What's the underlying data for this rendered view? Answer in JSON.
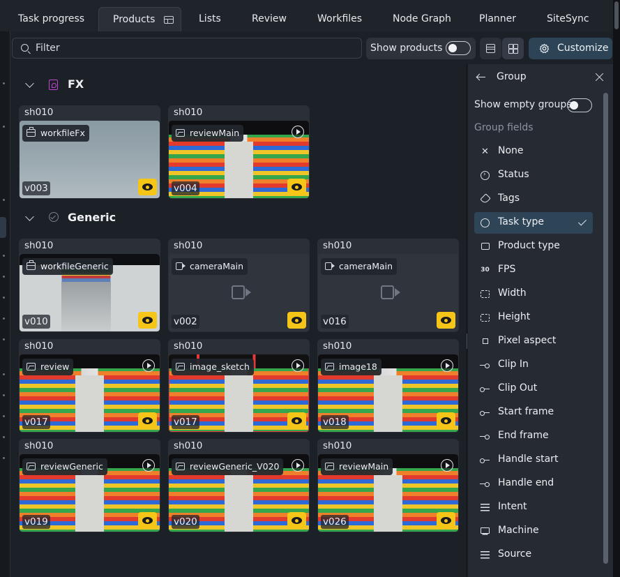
{
  "tabs": [
    {
      "label": "Task progress"
    },
    {
      "label": "Products"
    },
    {
      "label": "Lists"
    },
    {
      "label": "Review"
    },
    {
      "label": "Workfiles"
    },
    {
      "label": "Node Graph"
    },
    {
      "label": "Planner"
    },
    {
      "label": "SiteSync"
    }
  ],
  "active_tab": "Products",
  "toolbar": {
    "filter_label": "Filter",
    "show_products_label": "Show products",
    "show_products_on": false,
    "customize_label": "Customize",
    "view_mode": "grid"
  },
  "groups": [
    {
      "title": "FX",
      "icon": "fx-task-icon",
      "icon_color": "#c243d6",
      "cards": [
        {
          "shot": "sh010",
          "product": "workfileFx",
          "kind": "workfile",
          "version": "v003",
          "thumb": "fx-room",
          "playable": false
        },
        {
          "shot": "sh010",
          "product": "reviewMain",
          "kind": "image",
          "version": "v004",
          "thumb": "store",
          "playable": true
        }
      ]
    },
    {
      "title": "Generic",
      "icon": "check-circle-icon",
      "icon_color": "#7a808c",
      "cards": [
        {
          "shot": "sh010",
          "product": "workfileGeneric",
          "kind": "workfile",
          "version": "v010",
          "thumb": "shelves",
          "playable": false
        },
        {
          "shot": "sh010",
          "product": "cameraMain",
          "kind": "camera",
          "version": "v002",
          "thumb": "none",
          "playable": false
        },
        {
          "shot": "sh010",
          "product": "cameraMain",
          "kind": "camera",
          "version": "v016",
          "thumb": "none",
          "playable": false
        },
        {
          "shot": "sh010",
          "product": "review",
          "kind": "image",
          "version": "v017",
          "thumb": "store",
          "playable": true
        },
        {
          "shot": "sh010",
          "product": "image_sketch",
          "kind": "image",
          "version": "v017",
          "thumb": "sketch",
          "playable": true
        },
        {
          "shot": "sh010",
          "product": "image18",
          "kind": "image",
          "version": "v018",
          "thumb": "store",
          "playable": true
        },
        {
          "shot": "sh010",
          "product": "reviewGeneric",
          "kind": "image",
          "version": "v019",
          "thumb": "store",
          "playable": true
        },
        {
          "shot": "sh010",
          "product": "reviewGeneric_V020",
          "kind": "image",
          "version": "v020",
          "thumb": "store",
          "playable": true
        },
        {
          "shot": "sh010",
          "product": "reviewMain",
          "kind": "image",
          "version": "v026",
          "thumb": "store",
          "playable": true
        }
      ]
    }
  ],
  "panel": {
    "title": "Group",
    "show_empty_label": "Show empty groups",
    "show_empty_on": false,
    "fields_label": "Group fields",
    "selected": "Task type",
    "fields": [
      {
        "label": "None",
        "icon": "close-icon"
      },
      {
        "label": "Status",
        "icon": "arrow-circle-icon"
      },
      {
        "label": "Tags",
        "icon": "tag-icon"
      },
      {
        "label": "Task type",
        "icon": "check-circle-icon"
      },
      {
        "label": "Product type",
        "icon": "archive-icon"
      },
      {
        "label": "FPS",
        "icon": "fps-icon"
      },
      {
        "label": "Width",
        "icon": "width-icon"
      },
      {
        "label": "Height",
        "icon": "height-icon"
      },
      {
        "label": "Pixel aspect",
        "icon": "square-icon"
      },
      {
        "label": "Clip In",
        "icon": "clip-in-icon"
      },
      {
        "label": "Clip Out",
        "icon": "clip-out-icon"
      },
      {
        "label": "Start frame",
        "icon": "start-frame-icon"
      },
      {
        "label": "End frame",
        "icon": "end-frame-icon"
      },
      {
        "label": "Handle start",
        "icon": "handle-start-icon"
      },
      {
        "label": "Handle end",
        "icon": "handle-end-icon"
      },
      {
        "label": "Intent",
        "icon": "list-icon"
      },
      {
        "label": "Machine",
        "icon": "computer-icon"
      },
      {
        "label": "Source",
        "icon": "list-icon"
      }
    ]
  },
  "colors": {
    "accent": "#2d4457",
    "review_button": "#f5c518",
    "background": "#1c2027"
  }
}
